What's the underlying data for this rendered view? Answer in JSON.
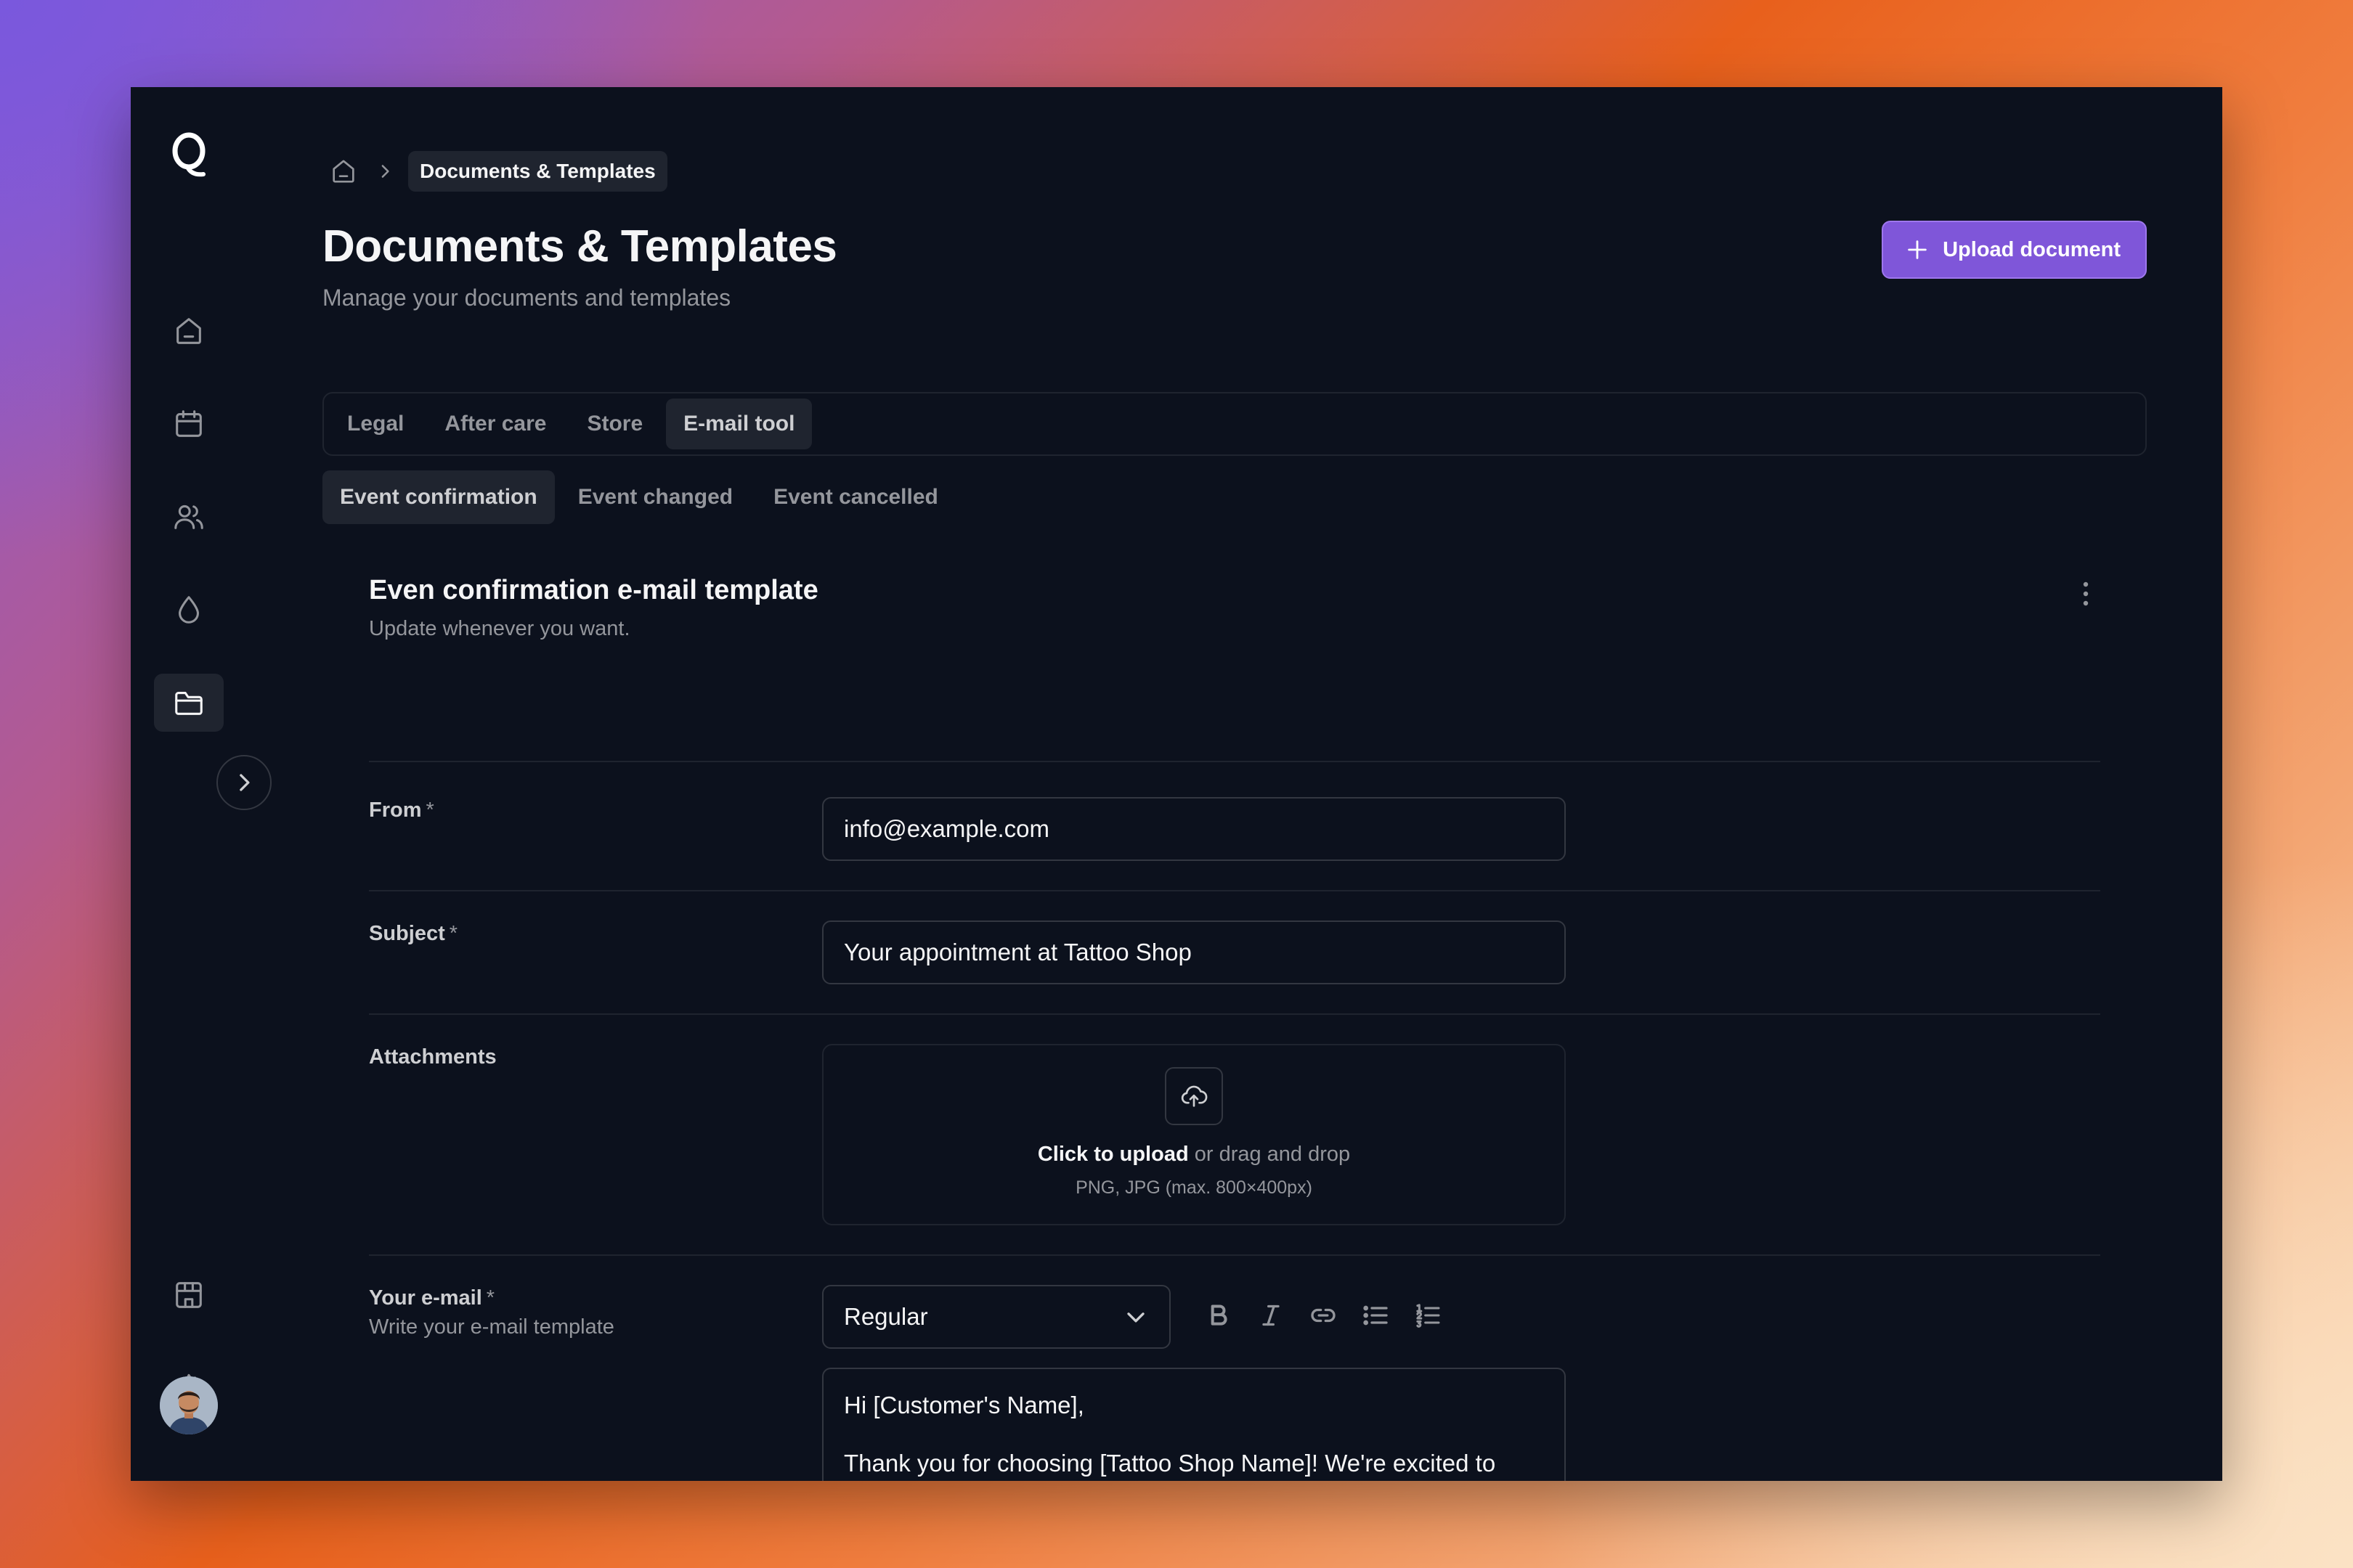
{
  "breadcrumb": {
    "current": "Documents & Templates"
  },
  "header": {
    "title": "Documents & Templates",
    "subtitle": "Manage your documents and templates",
    "upload_label": "Upload document"
  },
  "tabs": [
    {
      "label": "Legal",
      "active": false
    },
    {
      "label": "After care",
      "active": false
    },
    {
      "label": "Store",
      "active": false
    },
    {
      "label": "E-mail tool",
      "active": true
    }
  ],
  "subtabs": [
    {
      "label": "Event confirmation",
      "active": true
    },
    {
      "label": "Event changed",
      "active": false
    },
    {
      "label": "Event cancelled",
      "active": false
    }
  ],
  "card": {
    "title": "Even confirmation e-mail template",
    "subtitle": "Update whenever you want."
  },
  "form": {
    "required_mark": "*",
    "from": {
      "label": "From",
      "value": "info@example.com"
    },
    "subject": {
      "label": "Subject",
      "value": "Your appointment at Tattoo Shop"
    },
    "attachments": {
      "label": "Attachments",
      "upload_strong": "Click to upload",
      "upload_rest": " or drag and drop",
      "hint": "PNG, JPG (max. 800×400px)"
    },
    "email": {
      "label": "Your e-mail",
      "hint": "Write your e-mail template",
      "format_selected": "Regular",
      "body_line1": "Hi [Customer's Name],",
      "body_line2": "Thank you for choosing [Tattoo Shop Name]! We're excited to confirm your tattoo appointment with us. Here are the details of your booking:"
    }
  },
  "colors": {
    "background": "#0c111d",
    "accent": "#7f56d9",
    "active_tab": "#1f242f",
    "border": "#333741",
    "muted_text": "#94969c"
  },
  "icons": {
    "logo": "q-logo",
    "nav": [
      "home-icon",
      "calendar-icon",
      "users-icon",
      "drop-icon",
      "folder-icon"
    ],
    "bottom": [
      "store-icon",
      "gear-icon"
    ],
    "toolbar": [
      "bold-icon",
      "italic-icon",
      "link-icon",
      "bullet-list-icon",
      "numbered-list-icon"
    ]
  }
}
